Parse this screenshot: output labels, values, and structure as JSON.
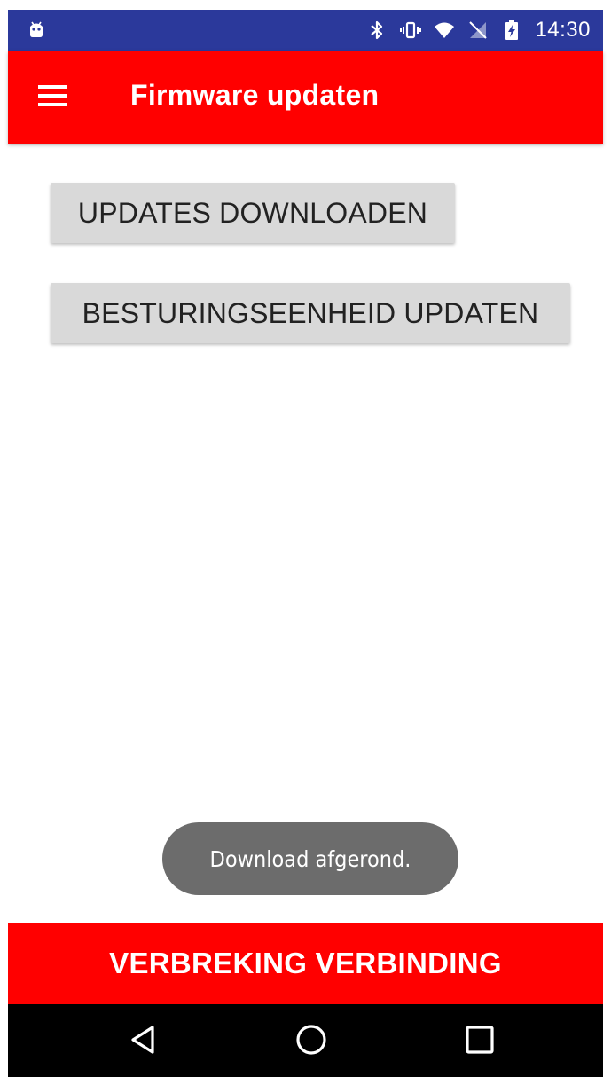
{
  "status_bar": {
    "time": "14:30",
    "icons": [
      "android-debug-icon",
      "bluetooth-icon",
      "vibrate-icon",
      "wifi-icon",
      "no-sim-icon",
      "battery-charging-icon"
    ]
  },
  "app_bar": {
    "title": "Firmware updaten",
    "menu_icon": "hamburger-menu-icon"
  },
  "buttons": {
    "download_label": "UPDATES DOWNLOADEN",
    "update_label": "BESTURINGSEENHEID UPDATEN"
  },
  "toast": {
    "message": "Download afgerond."
  },
  "disconnect": {
    "label": "VERBREKING VERBINDING"
  },
  "nav_bar": {
    "icons": [
      "back-icon",
      "home-icon",
      "recent-apps-icon"
    ]
  },
  "colors": {
    "status_bar": "#2b399b",
    "primary_red": "#ff0000",
    "button_gray": "#d9d9d9",
    "toast_gray": "#6c6c6c",
    "nav_black": "#000000"
  }
}
